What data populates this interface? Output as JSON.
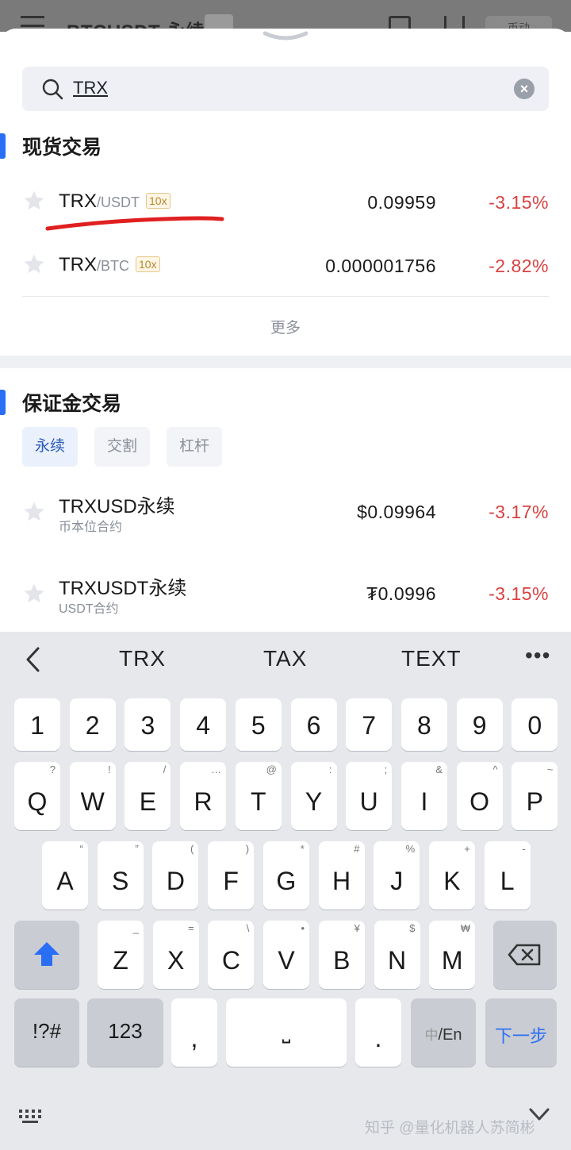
{
  "background_app": {
    "title": "BTCUSDT 永续",
    "button_label": "币动"
  },
  "search": {
    "query": "TRX",
    "clear_icon": "clear-icon"
  },
  "spot": {
    "title": "现货交易",
    "rows": [
      {
        "base": "TRX",
        "quote": "/USDT",
        "leverage": "10x",
        "price": "0.09959",
        "change": "-3.15%"
      },
      {
        "base": "TRX",
        "quote": "/BTC",
        "leverage": "10x",
        "price": "0.000001756",
        "change": "-2.82%"
      }
    ],
    "more_label": "更多"
  },
  "margin": {
    "title": "保证金交易",
    "tabs": [
      "永续",
      "交割",
      "杠杆"
    ],
    "active_tab": "永续",
    "rows": [
      {
        "name": "TRXUSD永续",
        "sub": "币本位合约",
        "price": "$0.09964",
        "change": "-3.17%"
      },
      {
        "name": "TRXUSDT永续",
        "sub": "USDT合约",
        "price": "₮0.0996",
        "change": "-3.15%"
      }
    ]
  },
  "colors": {
    "accent": "#2a6ef5",
    "negative": "#d94141",
    "leverage_badge": "#b7862c",
    "annotation": "#e02020"
  },
  "keyboard": {
    "suggestions": [
      "TRX",
      "TAX",
      "TEXT"
    ],
    "more_suggestions": "•••",
    "numbers": [
      "1",
      "2",
      "3",
      "4",
      "5",
      "6",
      "7",
      "8",
      "9",
      "0"
    ],
    "row1": [
      {
        "k": "Q",
        "h": "?"
      },
      {
        "k": "W",
        "h": "!"
      },
      {
        "k": "E",
        "h": "/"
      },
      {
        "k": "R",
        "h": "…"
      },
      {
        "k": "T",
        "h": "@"
      },
      {
        "k": "Y",
        "h": ":"
      },
      {
        "k": "U",
        "h": ";"
      },
      {
        "k": "I",
        "h": "&"
      },
      {
        "k": "O",
        "h": "^"
      },
      {
        "k": "P",
        "h": "~"
      }
    ],
    "row2": [
      {
        "k": "A",
        "h": "“"
      },
      {
        "k": "S",
        "h": "”"
      },
      {
        "k": "D",
        "h": "("
      },
      {
        "k": "F",
        "h": ")"
      },
      {
        "k": "G",
        "h": "*"
      },
      {
        "k": "H",
        "h": "#"
      },
      {
        "k": "J",
        "h": "%"
      },
      {
        "k": "K",
        "h": "+"
      },
      {
        "k": "L",
        "h": "-"
      }
    ],
    "row3": [
      {
        "k": "Z",
        "h": "_"
      },
      {
        "k": "X",
        "h": "="
      },
      {
        "k": "C",
        "h": "\\"
      },
      {
        "k": "V",
        "h": "•"
      },
      {
        "k": "B",
        "h": "¥"
      },
      {
        "k": "N",
        "h": "$"
      },
      {
        "k": "M",
        "h": "₩"
      }
    ],
    "symbols_label": "!?#",
    "numeric_label": "123",
    "comma": ",",
    "space_label": "⎵",
    "period": ".",
    "lang_cn": "中",
    "lang_en": "/En",
    "next_label": "下一步"
  },
  "watermark": "知乎 @量化机器人苏简彬"
}
